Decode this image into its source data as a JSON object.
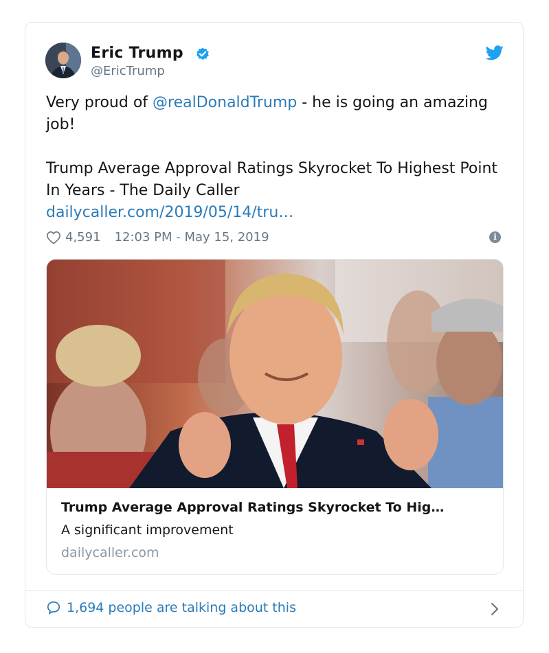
{
  "tweet": {
    "author_name": "Eric Trump",
    "author_handle": "@EricTrump",
    "text_prefix": "Very proud of ",
    "mention": "@realDonaldTrump",
    "text_suffix": " - he is going an amazing job!",
    "article_line": "Trump Average Approval Ratings Skyrocket To Highest Point In Years - The Daily Caller",
    "url": "dailycaller.com/2019/05/14/tru…",
    "likes": "4,591",
    "timestamp": "12:03 PM - May 15, 2019"
  },
  "link_card": {
    "title": "Trump Average Approval Ratings Skyrocket To Hig…",
    "description": "A significant improvement",
    "domain": "dailycaller.com"
  },
  "footer": {
    "talking_text": "1,694 people are talking about this"
  },
  "colors": {
    "link_blue": "#2b7bb9",
    "twitter_blue": "#1da1f2",
    "muted_gray": "#657786"
  },
  "icons": [
    "verified-badge-icon",
    "twitter-bird-icon",
    "heart-icon",
    "info-icon",
    "speech-bubble-icon",
    "chevron-right-icon"
  ]
}
